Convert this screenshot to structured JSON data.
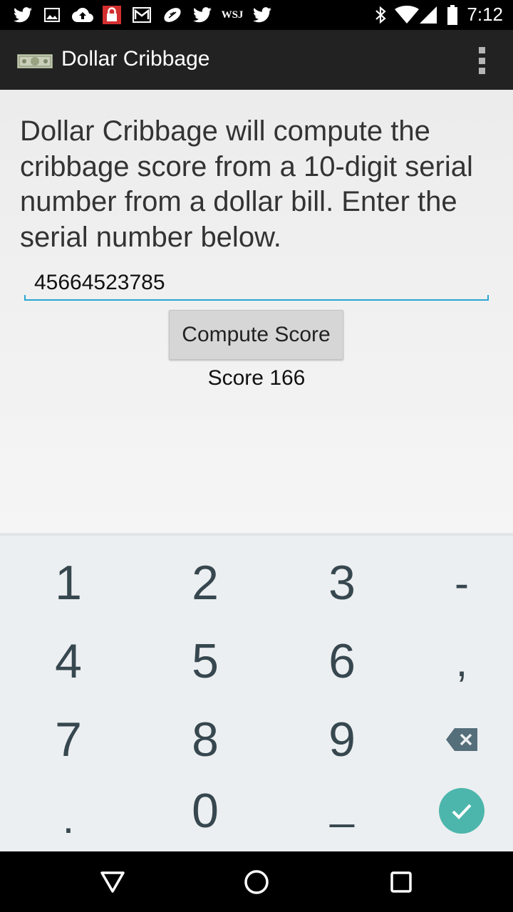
{
  "status_bar": {
    "time": "7:12",
    "left_icons": [
      "twitter-icon",
      "image-icon",
      "cloud-upload-icon",
      "lock-icon",
      "gmail-icon",
      "football-icon",
      "twitter-icon",
      "wsj-icon",
      "twitter-icon"
    ],
    "wsj_label": "WSJ",
    "right_icons": [
      "bluetooth-icon",
      "wifi-icon",
      "signal-icon",
      "battery-icon"
    ]
  },
  "action_bar": {
    "title": "Dollar Cribbage",
    "app_icon": "dollar-bill-icon",
    "overflow_icon": "overflow-menu-icon"
  },
  "main": {
    "description": "Dollar Cribbage will compute the cribbage score from a 10-digit serial number from a dollar bill. Enter the serial number below.",
    "serial_input": {
      "value": "45664523785"
    },
    "compute_button": "Compute Score",
    "score": "Score 166"
  },
  "keyboard": {
    "keys": {
      "k1": "1",
      "k2": "2",
      "k3": "3",
      "dash": "-",
      "k4": "4",
      "k5": "5",
      "k6": "6",
      "comma": ",",
      "k7": "7",
      "k8": "8",
      "k9": "9",
      "period": ".",
      "k0": "0",
      "space": "_"
    },
    "backspace_icon": "backspace-icon",
    "done_icon": "checkmark-icon",
    "accent_color": "#4db6ac"
  },
  "nav_bar": {
    "back_icon": "back-triangle-icon",
    "home_icon": "home-circle-icon",
    "recents_icon": "recents-square-icon"
  },
  "colors": {
    "status_bar": "#000000",
    "action_bar": "#222222",
    "input_accent": "#2aa6d3",
    "keyboard_bg": "#eceff1",
    "key_text": "#37474f"
  }
}
